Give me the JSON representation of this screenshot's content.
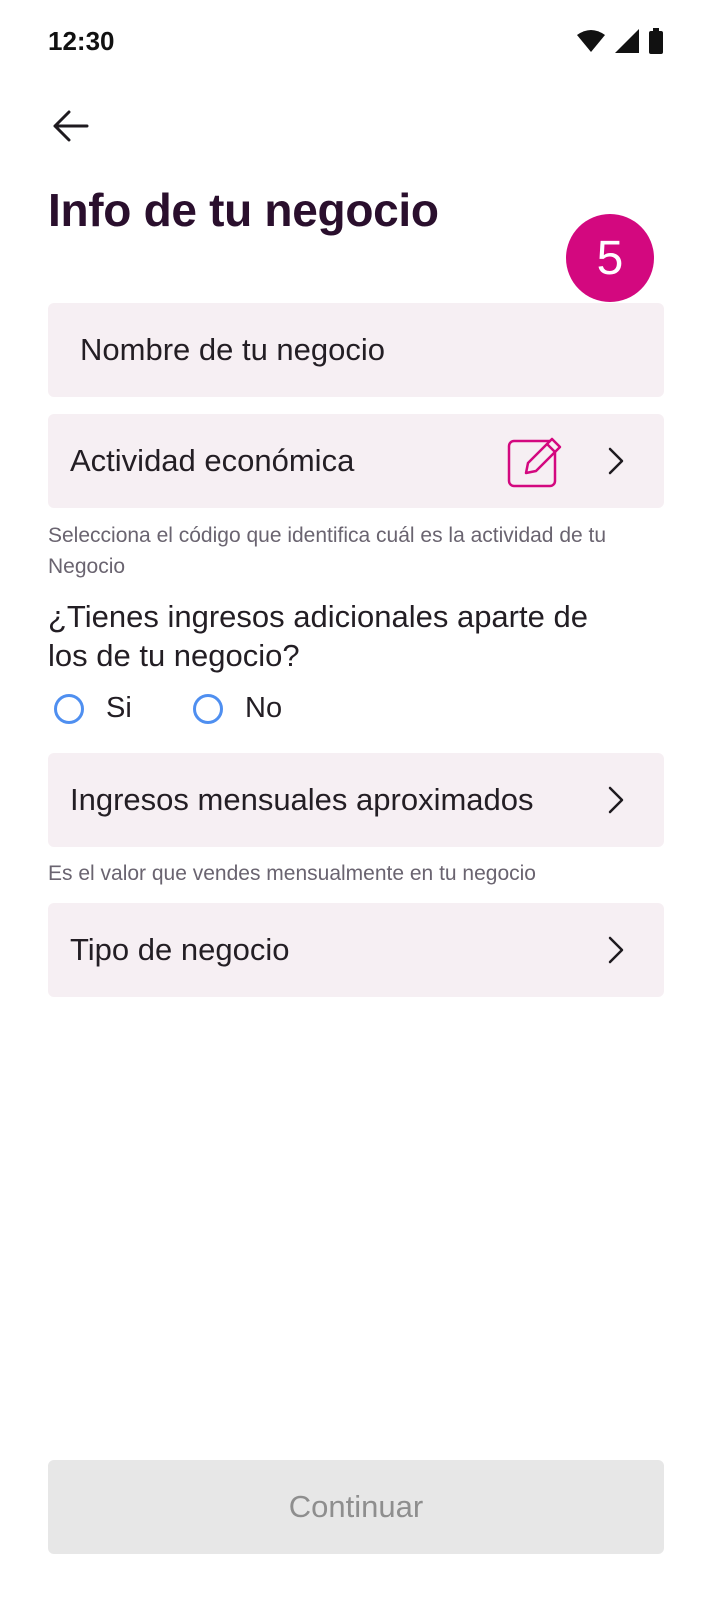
{
  "status_bar": {
    "time": "12:30",
    "icons": [
      "wifi-icon",
      "signal-icon",
      "battery-icon"
    ]
  },
  "header": {
    "back_icon": "arrow-left-icon",
    "title": "Info de tu negocio",
    "step": "5"
  },
  "form": {
    "business_name": {
      "placeholder": "Nombre de tu negocio"
    },
    "economic_activity": {
      "label": "Actividad económica",
      "icons": [
        "edit-icon",
        "chevron-right-icon"
      ],
      "helper": "Selecciona el código que identifica cuál es la actividad de tu Negocio"
    },
    "additional_income": {
      "question": "¿Tienes ingresos adicionales aparte de los de tu negocio?",
      "options": [
        {
          "label": "Si",
          "selected": false
        },
        {
          "label": "No",
          "selected": false
        }
      ]
    },
    "monthly_income": {
      "label": "Ingresos mensuales aproximados",
      "helper": "Es el valor que vendes mensualmente en tu negocio"
    },
    "business_type": {
      "label": "Tipo de negocio"
    }
  },
  "footer": {
    "continue_label": "Continuar",
    "enabled": false
  },
  "colors": {
    "accent": "#d3087f",
    "field_bg": "#f6eff3",
    "radio": "#4f8ff0",
    "disabled_bg": "#e7e7e7"
  }
}
